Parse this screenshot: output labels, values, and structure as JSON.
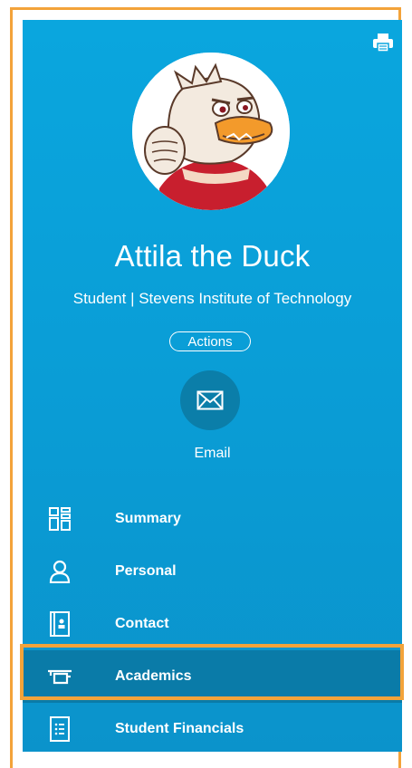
{
  "profile": {
    "name": "Attila the Duck",
    "subtitle": "Student | Stevens Institute of Technology",
    "actions_label": "Actions",
    "email_label": "Email"
  },
  "nav": {
    "items": [
      {
        "label": "Summary",
        "icon": "summary-grid-icon"
      },
      {
        "label": "Personal",
        "icon": "person-icon"
      },
      {
        "label": "Contact",
        "icon": "contact-book-icon"
      },
      {
        "label": "Academics",
        "icon": "graduation-cap-icon",
        "active": true
      },
      {
        "label": "Student Financials",
        "icon": "financials-list-icon"
      }
    ]
  },
  "colors": {
    "panel": "#0aa6de",
    "active_item": "#0a7ba8",
    "highlight": "#f3a33a",
    "text": "#ffffff"
  }
}
